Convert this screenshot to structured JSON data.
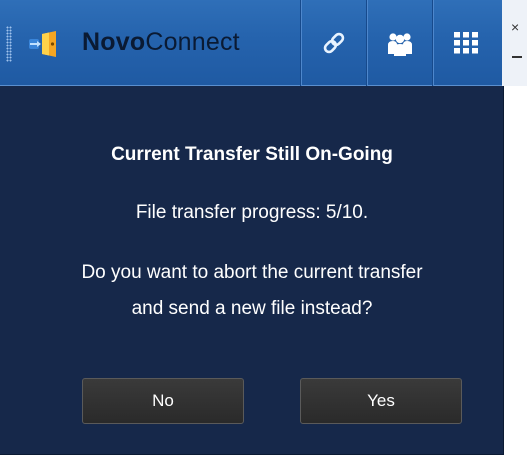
{
  "app": {
    "title_bold": "Novo",
    "title_rest": "Connect"
  },
  "toolbar": {
    "buttons": [
      {
        "icon": "link-icon"
      },
      {
        "icon": "users-icon"
      },
      {
        "icon": "grid-icon"
      }
    ],
    "close_glyph": "×"
  },
  "dialog": {
    "title": "Current Transfer Still On-Going",
    "progress_text": "File transfer progress: 5/10.",
    "question_line1": "Do you want to abort the current transfer",
    "question_line2": "and send a new file instead?",
    "no_label": "No",
    "yes_label": "Yes"
  },
  "colors": {
    "titlebar": "#2563ad",
    "background": "#16284a",
    "button": "#2f2f2f",
    "text": "#ffffff"
  }
}
